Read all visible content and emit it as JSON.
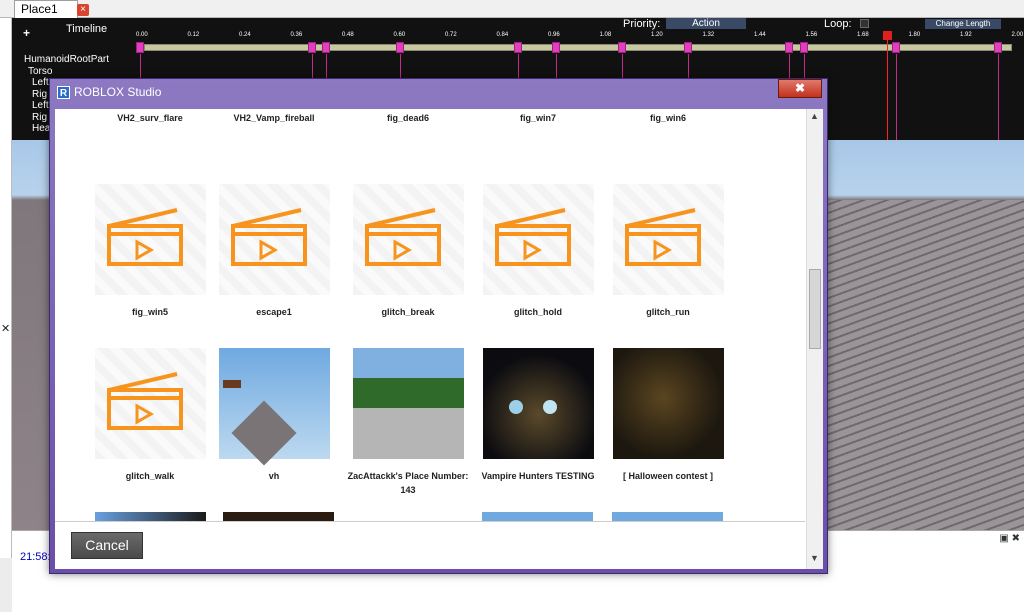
{
  "tab": {
    "title": "Place1",
    "close": "×"
  },
  "timeline": {
    "title": "Timeline",
    "add": "+",
    "priority_label": "Priority:",
    "priority_value": "Action",
    "loop_label": "Loop:",
    "change_length": "Change Length",
    "ticks": [
      "0.00",
      "0.12",
      "0.24",
      "0.36",
      "0.48",
      "0.60",
      "0.72",
      "0.84",
      "0.96",
      "1.08",
      "1.20",
      "1.32",
      "1.44",
      "1.56",
      "1.68",
      "1.80",
      "1.92",
      "2.00"
    ],
    "rows": [
      "HumanoidRootPart",
      "Torso",
      "Left",
      "Rig",
      "Left",
      "Rig",
      "Hea"
    ]
  },
  "output": {
    "timestamp": "21:58:",
    "controls": "▣ ✖"
  },
  "dialog": {
    "title": "ROBLOX Studio",
    "close": "✖",
    "top_labels": [
      "VH2_surv_flare",
      "VH2_Vamp_fireball",
      "fig_dead6",
      "fig_win7",
      "fig_win6"
    ],
    "row1": [
      "fig_win5",
      "escape1",
      "glitch_break",
      "glitch_hold",
      "glitch_run"
    ],
    "row2": [
      "glitch_walk",
      "vh",
      "ZacAttackk's Place Number: 143",
      "Vampire Hunters TESTING",
      "[ Halloween contest ]"
    ],
    "cancel": "Cancel",
    "colors": {
      "accent": "#f7941d"
    }
  }
}
